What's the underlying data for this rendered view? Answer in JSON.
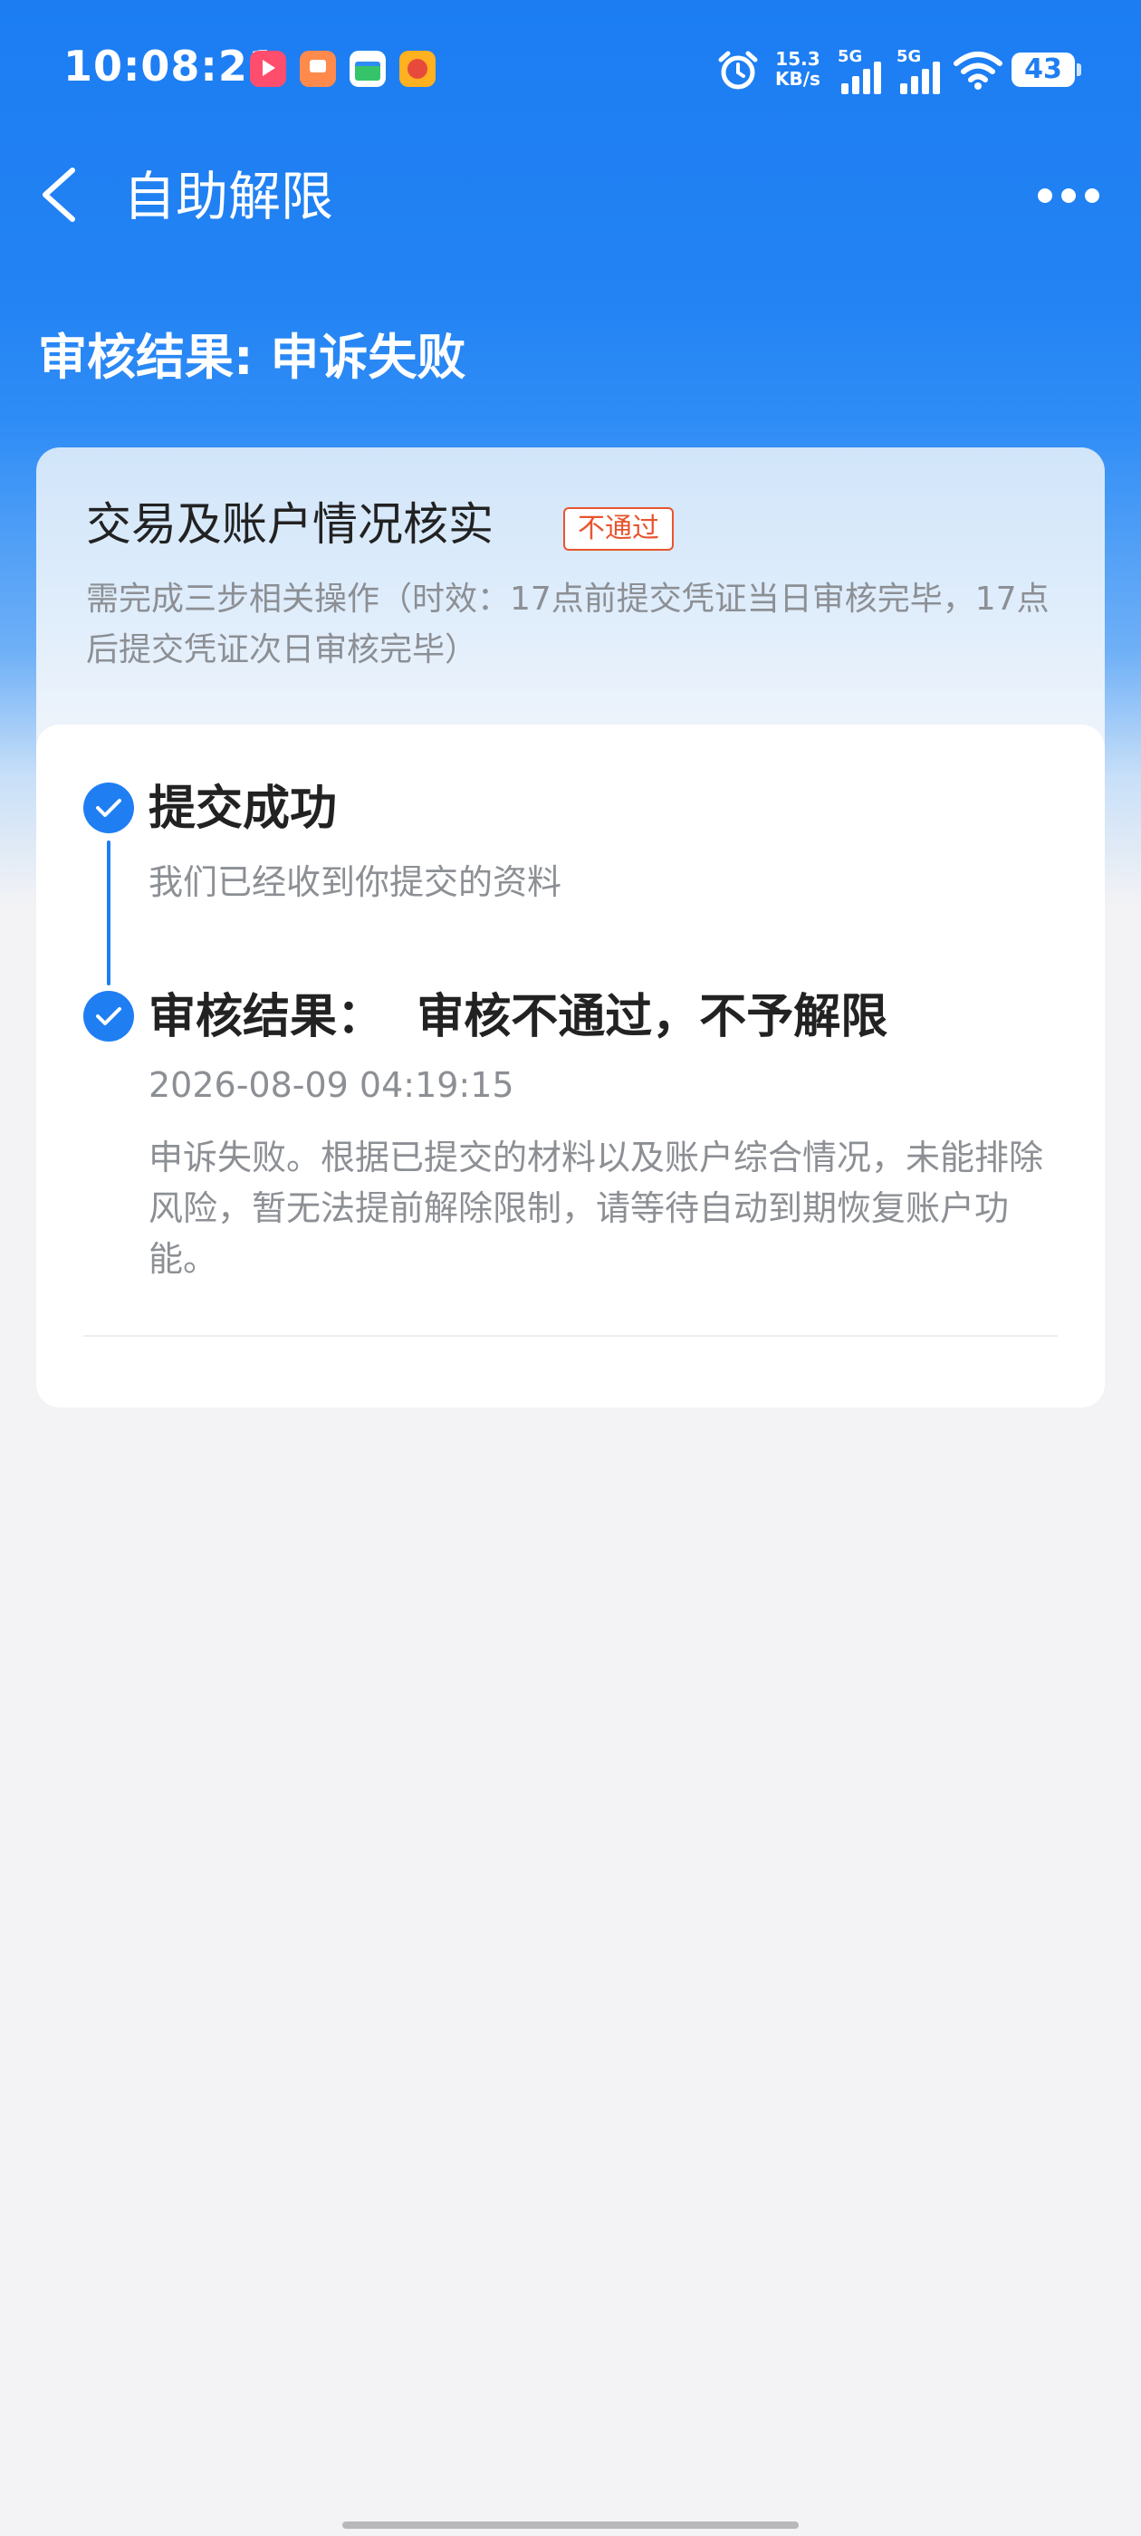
{
  "status_bar": {
    "time": "10:08:21",
    "net_speed_value": "15.3",
    "net_speed_unit": "KB/s",
    "signal_1_label": "5G",
    "signal_2_label": "5G",
    "battery_level": "43",
    "icons": [
      "video-app-icon",
      "notes-app-icon",
      "wallet-app-icon",
      "game-app-icon",
      "alarm-icon",
      "signal-icon",
      "wifi-icon",
      "battery-icon"
    ]
  },
  "nav": {
    "title": "自助解限",
    "icons": [
      "back-arrow-icon",
      "more-dots-icon"
    ]
  },
  "result": {
    "title": "审核结果: 申诉失败"
  },
  "card": {
    "title": "交易及账户情况核实",
    "badge": "不通过",
    "description": "需完成三步相关操作（时效：17点前提交凭证当日审核完毕，17点后提交凭证次日审核完毕）",
    "steps": [
      {
        "title": "提交成功",
        "description": "我们已经收到你提交的资料"
      },
      {
        "title": "审核结果：  审核不通过，不予解限",
        "time": "2026-08-09 04:19:15",
        "description": "申诉失败。根据已提交的材料以及账户综合情况，未能排除风险，暂无法提前解除限制，请等待自动到期恢复账户功能。"
      }
    ]
  },
  "colors": {
    "accent": "#1f7ef2",
    "header_gradient_top": "#1c7df3",
    "badge_red": "#e8542f",
    "page_background": "#f3f3f5",
    "muted_text": "#8c8f94"
  }
}
